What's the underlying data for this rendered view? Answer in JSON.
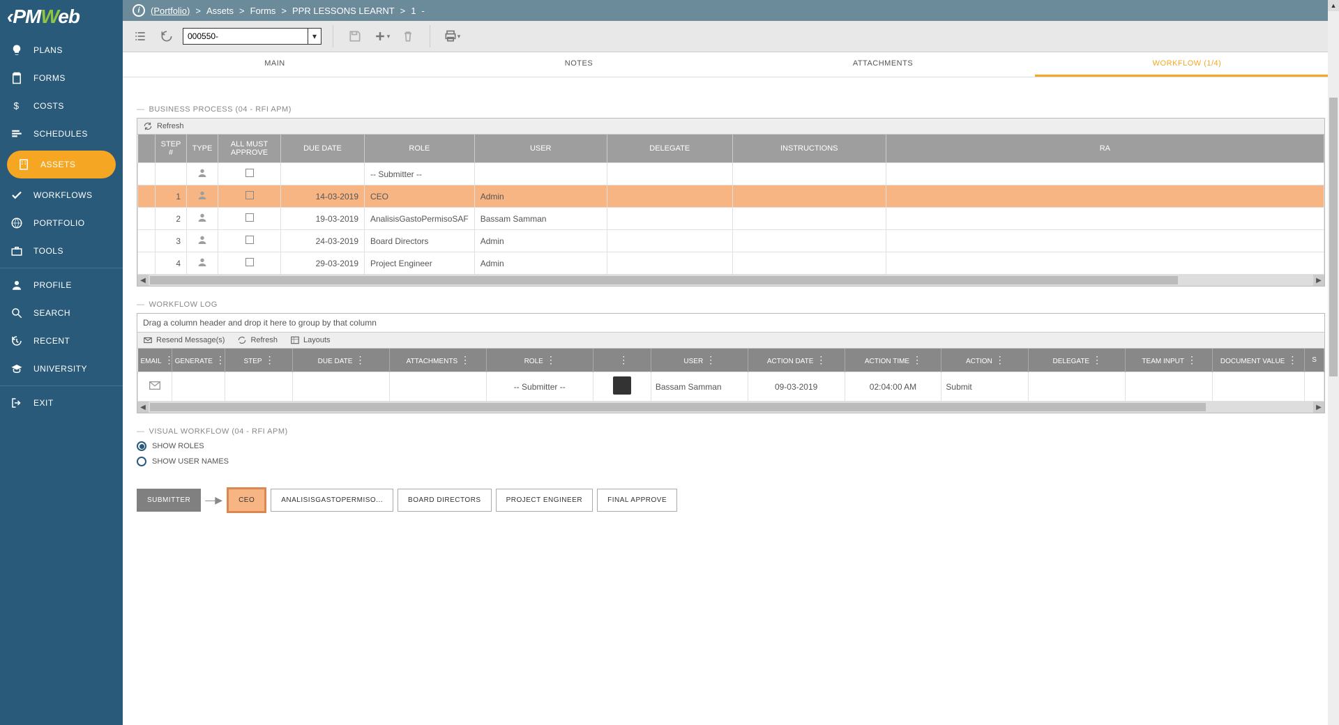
{
  "breadcrumb": {
    "portfolio": "(Portfolio)",
    "assets": "Assets",
    "forms": "Forms",
    "record_type": "PPR LESSONS LEARNT",
    "record_num": "1",
    "tail": "-"
  },
  "toolbar": {
    "record_value": "000550-"
  },
  "sidebar": {
    "items": [
      {
        "label": "PLANS",
        "icon": "bulb"
      },
      {
        "label": "FORMS",
        "icon": "clipboard"
      },
      {
        "label": "COSTS",
        "icon": "dollar"
      },
      {
        "label": "SCHEDULES",
        "icon": "bars"
      },
      {
        "label": "ASSETS",
        "icon": "building",
        "active": true
      },
      {
        "label": "WORKFLOWS",
        "icon": "check"
      },
      {
        "label": "PORTFOLIO",
        "icon": "globe"
      },
      {
        "label": "TOOLS",
        "icon": "briefcase"
      }
    ],
    "bottom": [
      {
        "label": "PROFILE",
        "icon": "person"
      },
      {
        "label": "SEARCH",
        "icon": "search"
      },
      {
        "label": "RECENT",
        "icon": "history"
      },
      {
        "label": "UNIVERSITY",
        "icon": "grad"
      },
      {
        "label": "EXIT",
        "icon": "exit"
      }
    ]
  },
  "tabs": {
    "main": "MAIN",
    "notes": "NOTES",
    "attachments": "ATTACHMENTS",
    "workflow": "WORKFLOW (1/4)"
  },
  "bp": {
    "title": "BUSINESS PROCESS (04 - RFI APM)",
    "refresh": "Refresh",
    "headers": {
      "step": "STEP #",
      "type": "TYPE",
      "all_must": "ALL MUST APPROVE",
      "due": "DUE DATE",
      "role": "ROLE",
      "user": "USER",
      "delegate": "DELEGATE",
      "instructions": "INSTRUCTIONS",
      "ra": "RA"
    },
    "rows": [
      {
        "step": "",
        "due": "",
        "role": "-- Submitter --",
        "user": "",
        "hl": false
      },
      {
        "step": "1",
        "due": "14-03-2019",
        "role": "CEO",
        "user": "Admin",
        "hl": true
      },
      {
        "step": "2",
        "due": "19-03-2019",
        "role": "AnalisisGastoPermisoSAF",
        "user": "Bassam Samman",
        "hl": false
      },
      {
        "step": "3",
        "due": "24-03-2019",
        "role": "Board Directors",
        "user": "Admin",
        "hl": false
      },
      {
        "step": "4",
        "due": "29-03-2019",
        "role": "Project Engineer",
        "user": "Admin",
        "hl": false
      }
    ]
  },
  "wl": {
    "title": "WORKFLOW LOG",
    "group_hint": "Drag a column header and drop it here to group by that column",
    "resend": "Resend Message(s)",
    "refresh": "Refresh",
    "layouts": "Layouts",
    "headers": {
      "email": "EMAIL",
      "generate": "GENERATE",
      "step": "STEP",
      "due": "DUE DATE",
      "attach": "ATTACHMENTS",
      "role": "ROLE",
      "img": "",
      "user": "USER",
      "ad": "ACTION DATE",
      "at": "ACTION TIME",
      "action": "ACTION",
      "delegate": "DELEGATE",
      "team": "TEAM INPUT",
      "doc": "DOCUMENT VALUE",
      "s": "S"
    },
    "row": {
      "role": "-- Submitter --",
      "user": "Bassam Samman",
      "ad": "09-03-2019",
      "at": "02:04:00 AM",
      "action": "Submit"
    }
  },
  "vw": {
    "title": "VISUAL WORKFLOW (04 - RFI APM)",
    "show_roles": "SHOW ROLES",
    "show_users": "SHOW USER NAMES",
    "boxes": {
      "submitter": "SUBMITTER",
      "ceo": "CEO",
      "analisis": "ANALISISGASTOPERMISO...",
      "board": "BOARD DIRECTORS",
      "proj": "PROJECT ENGINEER",
      "final": "FINAL APPROVE"
    }
  }
}
